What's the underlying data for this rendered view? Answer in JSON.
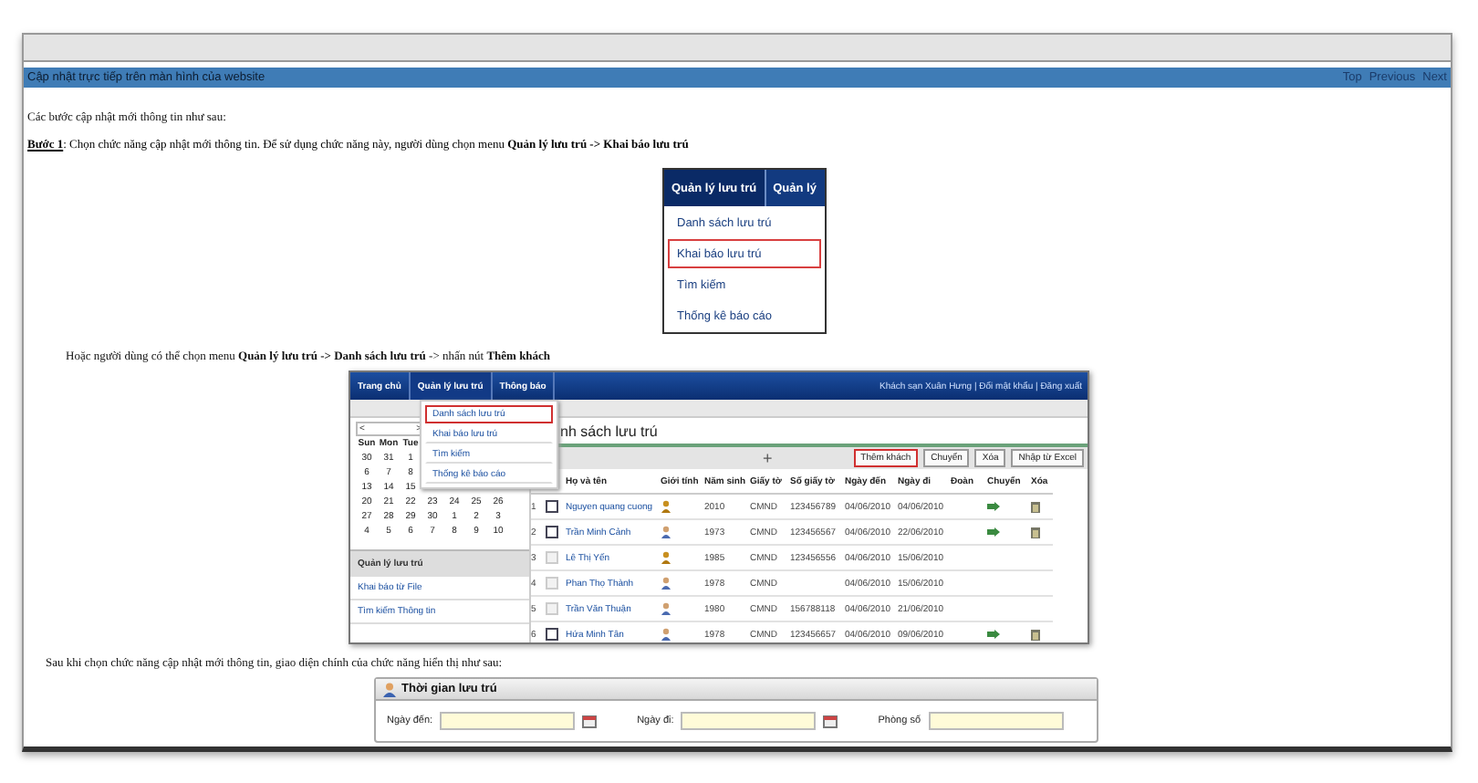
{
  "header_bar": {
    "title": "Cập nhật trực tiếp trên màn hình của website",
    "links": [
      "Top",
      "Previous",
      "Next"
    ]
  },
  "intro": "Các bước cập nhật mới thông tin như sau:",
  "step": {
    "label": "Bước 1",
    "text": ": Chọn chức năng cập nhật mới thông tin. Để sử dụng chức năng này, người dùng chọn menu **Quản lý lưu trú -> Khai báo lưu trú**"
  },
  "menu_figure": {
    "tabs": [
      {
        "label": "Quản lý lưu trú",
        "selected": true
      },
      {
        "label": "Quản lý",
        "selected": false
      }
    ],
    "items": [
      {
        "label": "Danh sách lưu trú",
        "selected": false
      },
      {
        "label": "Khai báo lưu trú",
        "selected": true
      },
      {
        "label": "Tìm kiếm",
        "selected": false
      },
      {
        "label": "Thống kê báo cáo",
        "selected": false
      }
    ]
  },
  "alternative": "Hoặc người dùng có thể chọn menu **Quản lý lưu trú -> Danh sách lưu trú** -> nhấn nút **Thêm khách**",
  "app_screenshot": {
    "nav": {
      "tabs": [
        {
          "label": "Trang chủ",
          "selected": false
        },
        {
          "label": "Quản lý lưu trú",
          "selected": true
        },
        {
          "label": "Thông báo",
          "selected": false
        }
      ],
      "user_links": "Khách sạn Xuân Hưng | Đổi mật khẩu | Đăng xuất"
    },
    "dropdown": [
      {
        "label": "Danh sách lưu trú",
        "selected": true
      },
      {
        "label": "Khai báo lưu trú",
        "selected": false
      },
      {
        "label": "Tìm kiếm",
        "selected": false
      },
      {
        "label": "Thống kê báo cáo",
        "selected": false
      }
    ],
    "calendar": {
      "prev": "<",
      "next": ">",
      "weekdays": [
        "Sun",
        "Mon",
        "Tue"
      ],
      "weeks": [
        [
          "30",
          "31",
          "1"
        ],
        [
          "6",
          "7",
          "8"
        ],
        [
          "13",
          "14",
          "15"
        ],
        [
          "20",
          "21",
          "22",
          "23",
          "24",
          "25",
          "26"
        ],
        [
          "27",
          "28",
          "29",
          "30",
          "1",
          "2",
          "3"
        ],
        [
          "4",
          "5",
          "6",
          "7",
          "8",
          "9",
          "10"
        ]
      ]
    },
    "side_menu": {
      "title": "Quản lý lưu trú",
      "items": [
        "Khai báo từ File",
        "Tìm kiếm Thông tin"
      ]
    },
    "page_title": "nh sách lưu trú",
    "toolbar": {
      "add": "+",
      "buttons": [
        {
          "label": "Thêm khách",
          "selected": true
        },
        {
          "label": "Chuyển",
          "selected": false
        },
        {
          "label": "Xóa",
          "selected": false
        },
        {
          "label": "Nhập từ Excel",
          "selected": false
        }
      ]
    },
    "table": {
      "columns": [
        "Họ và tên",
        "Giới tính",
        "Năm sinh",
        "Giấy tờ",
        "Số giấy tờ",
        "Ngày đến",
        "Ngày đi",
        "Đoàn",
        "Chuyển",
        "Xóa"
      ],
      "rows": [
        {
          "no": "1",
          "disabled": false,
          "name": "Nguyen quang cuong",
          "female": true,
          "year": "2010",
          "doc_type": "CMND",
          "doc_no": "123456789",
          "arrive": "04/06/2010",
          "leave": "04/06/2010",
          "can_move": true,
          "can_delete": true
        },
        {
          "no": "2",
          "disabled": false,
          "name": "Trần Minh Cảnh",
          "female": false,
          "year": "1973",
          "doc_type": "CMND",
          "doc_no": "123456567",
          "arrive": "04/06/2010",
          "leave": "22/06/2010",
          "can_move": true,
          "can_delete": true
        },
        {
          "no": "3",
          "disabled": true,
          "name": "Lê Thị Yến",
          "female": true,
          "year": "1985",
          "doc_type": "CMND",
          "doc_no": "123456556",
          "arrive": "04/06/2010",
          "leave": "15/06/2010",
          "can_move": false,
          "can_delete": false
        },
        {
          "no": "4",
          "disabled": true,
          "name": "Phan Thọ Thành",
          "female": false,
          "year": "1978",
          "doc_type": "CMND",
          "arrive": "04/06/2010",
          "leave": "15/06/2010",
          "can_move": false,
          "can_delete": false
        },
        {
          "no": "5",
          "disabled": true,
          "name": "Trần Văn Thuận",
          "female": false,
          "year": "1980",
          "doc_type": "CMND",
          "doc_no": "156788118",
          "arrive": "04/06/2010",
          "leave": "21/06/2010",
          "can_move": false,
          "can_delete": false
        },
        {
          "no": "6",
          "disabled": false,
          "name": "Hứa Minh Tân",
          "female": false,
          "year": "1978",
          "doc_type": "CMND",
          "doc_no": "123456657",
          "arrive": "04/06/2010",
          "leave": "09/06/2010",
          "can_move": true,
          "can_delete": true
        }
      ]
    }
  },
  "after_text": "Sau khi  chọn chức năng cập nhật mới thông tin, giao diện chính của chức năng hiển thị như sau:",
  "stay_panel": {
    "title": "Thời gian lưu trú",
    "fields": [
      {
        "label": "Ngày đến:",
        "date_picker": true
      },
      {
        "label": "Ngày đi:",
        "date_picker": true
      },
      {
        "label": "Phòng số",
        "date_picker": false
      }
    ]
  }
}
